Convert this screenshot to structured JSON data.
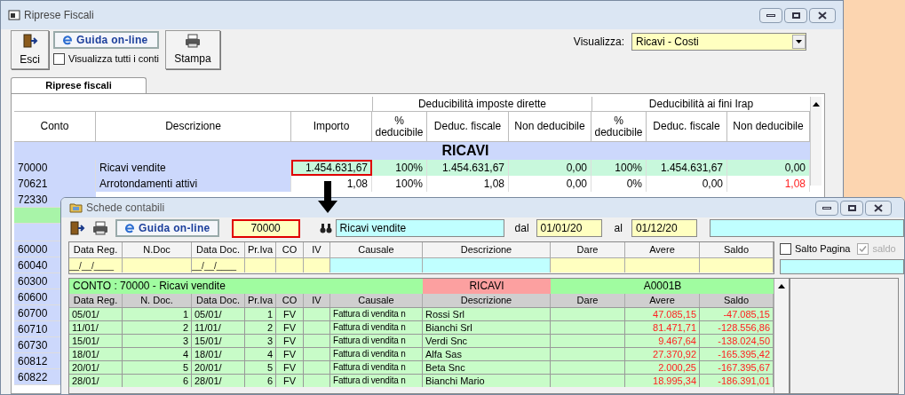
{
  "back_window": {
    "title": "Riprese Fiscali",
    "toolbar": {
      "exit_button": "Esci",
      "help_button": "Guida on-line",
      "show_all_checkbox": {
        "label": "Visualizza tutti i conti",
        "checked": false
      },
      "print_button": "Stampa"
    },
    "view_select": {
      "label": "Visualizza:",
      "value": "Ricavi - Costi"
    },
    "tabs": [
      {
        "label": "Riprese fiscali",
        "selected": true
      }
    ],
    "table": {
      "group_headers": [
        "Deducibilità imposte dirette",
        "Deducibilità ai fini Irap"
      ],
      "columns": [
        "Conto",
        "Descrizione",
        "Importo",
        "% deducibile",
        "Deduc. fiscale",
        "Non deducibile",
        "% deducibile",
        "Deduc. fiscale",
        "Non deducibile"
      ],
      "section": "RICAVI",
      "rows": [
        {
          "cells": [
            "70000",
            "Ricavi vendite",
            "1.454.631,67",
            "100%",
            "1.454.631,67",
            "0,00",
            "100%",
            "1.454.631,67",
            "0,00"
          ],
          "selected": true,
          "last_alert": false
        },
        {
          "cells": [
            "70621",
            "Arrotondamenti attivi",
            "1,08",
            "100%",
            "1,08",
            "0,00",
            "0%",
            "0,00",
            "1,08"
          ],
          "selected": false,
          "last_alert": true
        }
      ],
      "covered_rows": [
        {
          "kind": "account",
          "conto": "72330"
        },
        {
          "kind": "highlight"
        },
        {
          "kind": "section"
        },
        {
          "kind": "account",
          "conto": "60000"
        },
        {
          "kind": "account",
          "conto": "60040"
        },
        {
          "kind": "account",
          "conto": "60300"
        },
        {
          "kind": "account",
          "conto": "60600"
        },
        {
          "kind": "account",
          "conto": "60700"
        },
        {
          "kind": "account",
          "conto": "60710"
        },
        {
          "kind": "account",
          "conto": "60730"
        },
        {
          "kind": "account",
          "conto": "60812"
        },
        {
          "kind": "account",
          "conto": "60822"
        }
      ]
    }
  },
  "front_window": {
    "title": "Schede contabili",
    "help_button": "Guida on-line",
    "account_field": "70000",
    "description_field": "Ricavi vendite",
    "from_label": "dal",
    "from_date": "01/01/20",
    "to_label": "al",
    "to_date": "01/12/20",
    "filter_columns": [
      {
        "label": "Data Reg.",
        "kind": "date",
        "placeholder": "__/__/____"
      },
      {
        "label": "N.Doc",
        "kind": "text"
      },
      {
        "label": "Data Doc.",
        "kind": "date",
        "placeholder": "__/__/____"
      },
      {
        "label": "Pr.Iva",
        "kind": "text"
      },
      {
        "label": "CO",
        "kind": "text"
      },
      {
        "label": "IV",
        "kind": "text"
      },
      {
        "label": "Causale",
        "kind": "lookup"
      },
      {
        "label": "Descrizione",
        "kind": "lookup"
      },
      {
        "label": "Dare",
        "kind": "text"
      },
      {
        "label": "Avere",
        "kind": "text"
      },
      {
        "label": "Saldo",
        "kind": "text"
      }
    ],
    "page_break_checkbox": {
      "label": "Salto Pagina",
      "checked": false
    },
    "balance_checkbox": {
      "label": "saldo",
      "checked": true,
      "disabled": true
    },
    "grid": {
      "account_title": "CONTO :  70000 - Ricavi vendite",
      "category": "RICAVI",
      "code": "A0001B",
      "columns": [
        "Data Reg.",
        "N. Doc.",
        "Data Doc.",
        "Pr.Iva",
        "CO",
        "IV",
        "Causale",
        "Descrizione",
        "Dare",
        "Avere",
        "Saldo"
      ],
      "rows": [
        {
          "data_reg": "05/01/",
          "n_doc": "1",
          "data_doc": "05/01/",
          "pr_iva": "1",
          "co": "FV",
          "causale": "Fattura di vendita n",
          "descrizione": "Rossi Srl",
          "avere": "47.085,15",
          "saldo": "-47.085,15"
        },
        {
          "data_reg": "11/01/",
          "n_doc": "2",
          "data_doc": "11/01/",
          "pr_iva": "2",
          "co": "FV",
          "causale": "Fattura di vendita n",
          "descrizione": "Bianchi Srl",
          "avere": "81.471,71",
          "saldo": "-128.556,86"
        },
        {
          "data_reg": "15/01/",
          "n_doc": "3",
          "data_doc": "15/01/",
          "pr_iva": "3",
          "co": "FV",
          "causale": "Fattura di vendita n",
          "descrizione": "Verdi Snc",
          "avere": "9.467,64",
          "saldo": "-138.024,50"
        },
        {
          "data_reg": "18/01/",
          "n_doc": "4",
          "data_doc": "18/01/",
          "pr_iva": "4",
          "co": "FV",
          "causale": "Fattura di vendita n",
          "descrizione": "Alfa Sas",
          "avere": "27.370,92",
          "saldo": "-165.395,42"
        },
        {
          "data_reg": "20/01/",
          "n_doc": "5",
          "data_doc": "20/01/",
          "pr_iva": "5",
          "co": "FV",
          "causale": "Fattura di vendita n",
          "descrizione": "Beta Snc",
          "avere": "2.000,25",
          "saldo": "-167.395,67"
        },
        {
          "data_reg": "28/01/",
          "n_doc": "6",
          "data_doc": "28/01/",
          "pr_iva": "6",
          "co": "FV",
          "causale": "Fattura di vendita n",
          "descrizione": "Bianchi Mario",
          "avere": "18.995,34",
          "saldo": "-186.391,01"
        }
      ]
    }
  }
}
